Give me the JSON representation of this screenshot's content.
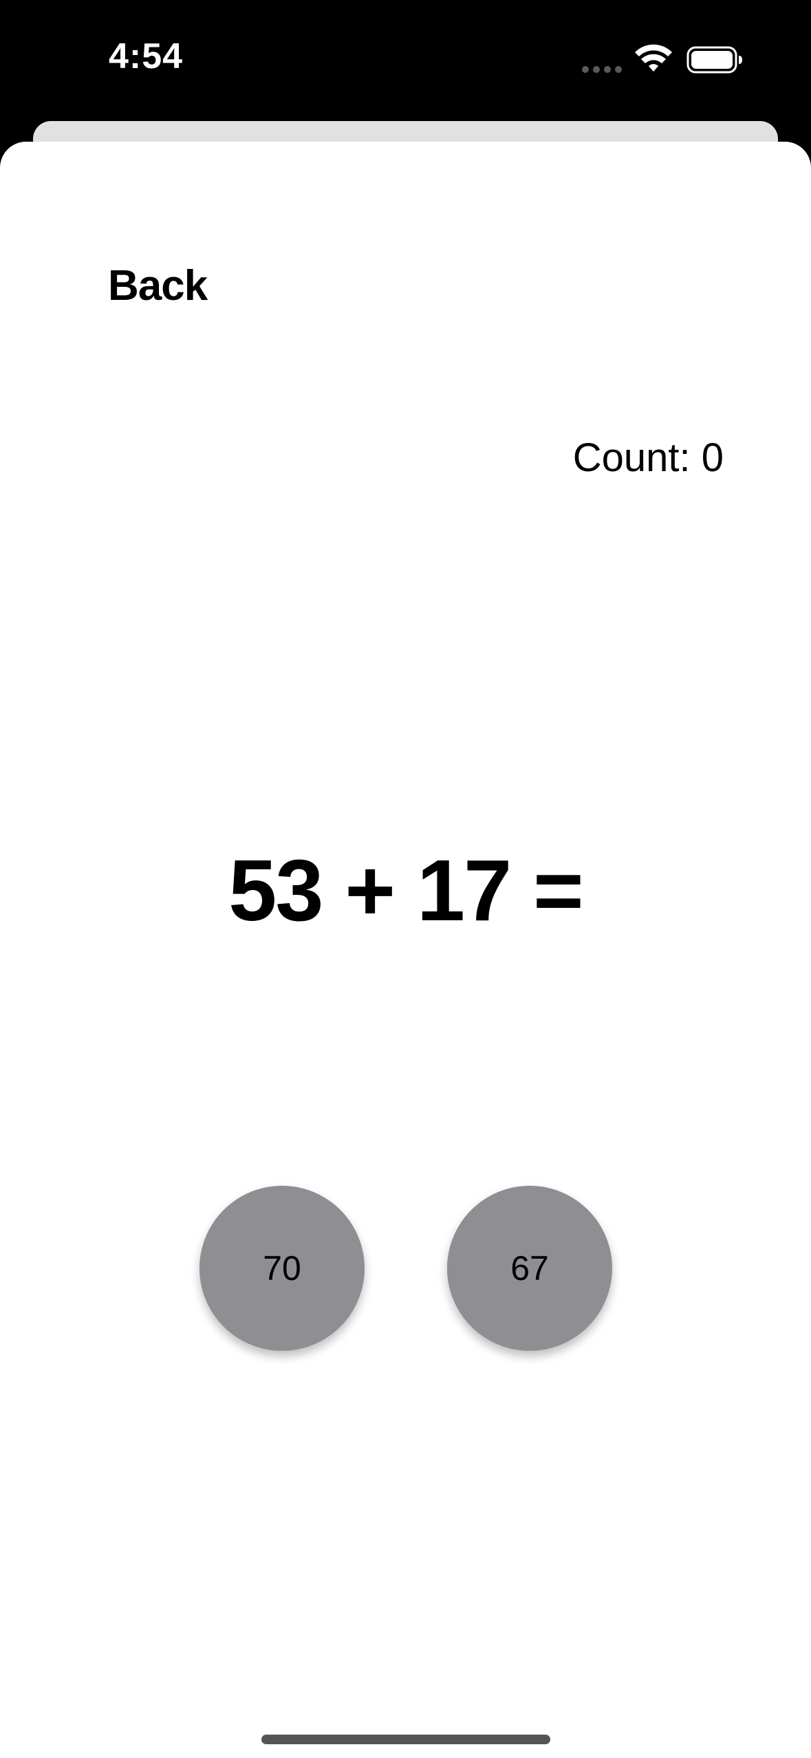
{
  "status_bar": {
    "time": "4:54",
    "icons": [
      "signal-dots-icon",
      "wifi-icon",
      "battery-icon"
    ]
  },
  "nav": {
    "back_label": "Back"
  },
  "score": {
    "count_label": "Count: 0"
  },
  "question": {
    "equation": "53 + 17 ="
  },
  "answers": [
    {
      "label": "70"
    },
    {
      "label": "67"
    }
  ],
  "colors": {
    "status_background": "#000000",
    "sheet_background": "#ffffff",
    "sheet_behind": "#e1e1e1",
    "answer_button": "#8e8e93",
    "text": "#000000"
  }
}
